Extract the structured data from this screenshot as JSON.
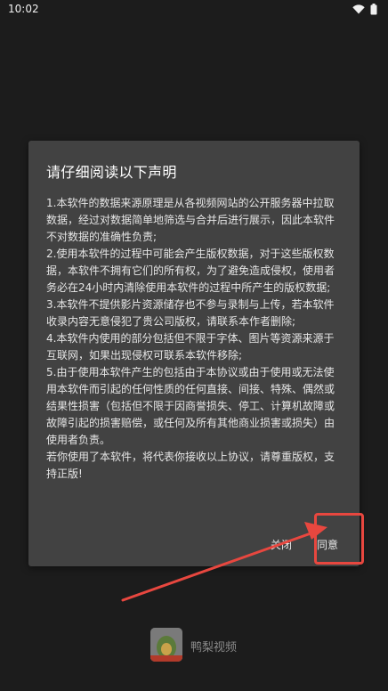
{
  "status_bar": {
    "time": "10:02",
    "icons": [
      "wifi-icon",
      "battery-icon"
    ]
  },
  "dialog": {
    "title": "请仔细阅读以下声明",
    "body": "1.本软件的数据来源原理是从各视频网站的公开服务器中拉取数据，经过对数据简单地筛选与合并后进行展示，因此本软件不对数据的准确性负责;\n2.使用本软件的过程中可能会产生版权数据，对于这些版权数据，本软件不拥有它们的所有权，为了避免造成侵权，使用者务必在24小时内清除使用本软件的过程中所产生的版权数据;\n3.本软件不提供影片资源储存也不参与录制与上传，若本软件收录内容无意侵犯了贵公司版权，请联系本作者删除;\n4.本软件内使用的部分包括但不限于字体、图片等资源来源于互联网，如果出现侵权可联系本软件移除;\n5.由于使用本软件产生的包括由于本协议或由于使用或无法使用本软件而引起的任何性质的任何直接、间接、特殊、偶然或结果性损害（包括但不限于因商誉损失、停工、计算机故障或故障引起的损害赔偿，或任何及所有其他商业损害或损失）由使用者负责。\n若你使用了本软件，将代表你接收以上协议，请尊重版权，支持正版!",
    "close_label": "关闭",
    "agree_label": "同意"
  },
  "splash": {
    "app_name": "鸭梨视频"
  },
  "colors": {
    "background": "#1c1c1c",
    "dialog": "#424242",
    "annotation": "#e8473f"
  }
}
